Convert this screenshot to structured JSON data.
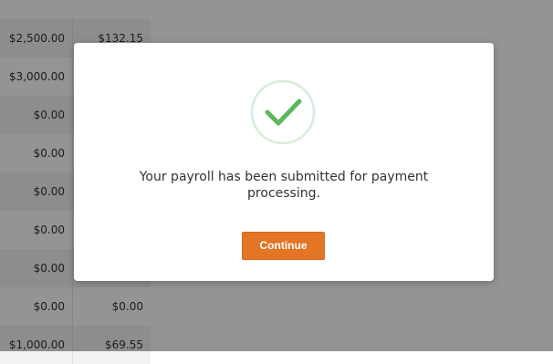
{
  "table": {
    "rows": [
      {
        "col1": "$2,500.00",
        "col2": "$132.15"
      },
      {
        "col1": "$3,000.00",
        "col2": ""
      },
      {
        "col1": "$0.00",
        "col2": ""
      },
      {
        "col1": "$0.00",
        "col2": ""
      },
      {
        "col1": "$0.00",
        "col2": ""
      },
      {
        "col1": "$0.00",
        "col2": ""
      },
      {
        "col1": "$0.00",
        "col2": ""
      },
      {
        "col1": "$0.00",
        "col2": "$0.00"
      },
      {
        "col1": "$1,000.00",
        "col2": "$69.55"
      }
    ]
  },
  "modal": {
    "icon": "checkmark-circle-icon",
    "message": "Your payroll has been submitted for payment processing.",
    "continue_label": "Continue"
  },
  "colors": {
    "accent": "#e37524",
    "success": "#5cb85c",
    "success_ring": "#d8ecd8"
  }
}
